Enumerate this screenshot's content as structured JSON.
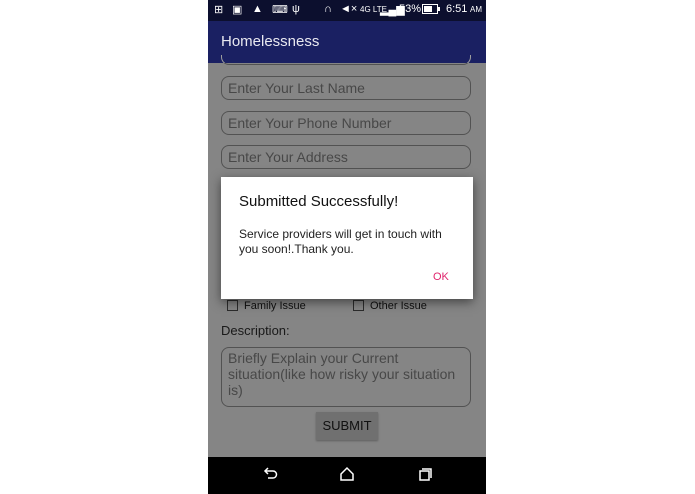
{
  "status_bar": {
    "battery": "53%",
    "time": "6:51",
    "ampm": "AM",
    "network": "4G LTE"
  },
  "app_bar": {
    "title": "Homelessness"
  },
  "form": {
    "last_name_placeholder": "Enter Your Last Name",
    "phone_placeholder": "Enter Your Phone Number",
    "address_placeholder": "Enter Your Address",
    "checkbox_family": "Family Issue",
    "checkbox_other": "Other Issue",
    "description_label": "Description:",
    "description_placeholder": "Briefly Explain your Current situation(like   how risky your situation is)",
    "submit_label": "SUBMIT"
  },
  "dialog": {
    "title": "Submitted Successfully!",
    "message": "Service providers will get in touch with you soon!.Thank you.",
    "ok_label": "OK"
  },
  "icons": [
    "notification-icon",
    "photo-icon",
    "cart-icon",
    "code-icon",
    "usb-icon",
    "headset-icon",
    "mute-icon",
    "signal-icon",
    "battery-icon",
    "back-icon",
    "home-icon",
    "recents-icon"
  ]
}
